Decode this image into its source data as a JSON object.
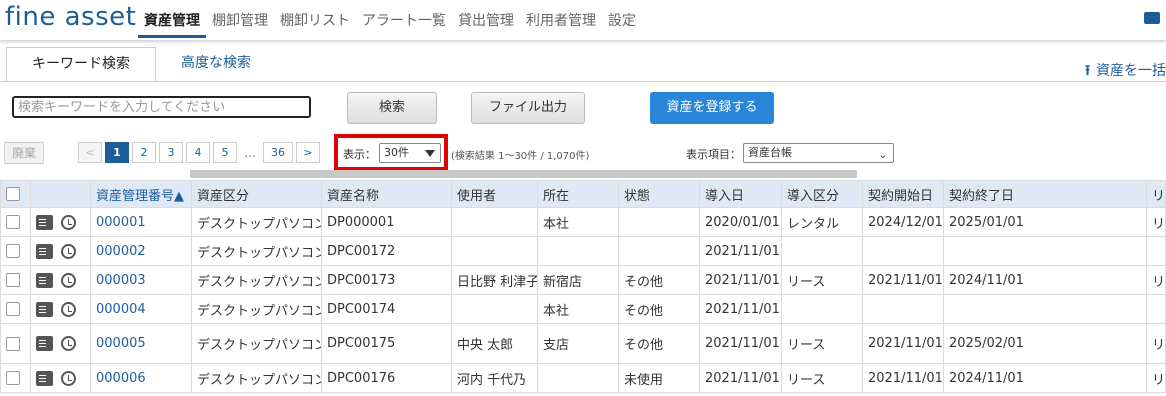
{
  "app": {
    "logo": "fine asset"
  },
  "nav": [
    {
      "label": "資産管理",
      "active": true
    },
    {
      "label": "棚卸管理"
    },
    {
      "label": "棚卸リスト"
    },
    {
      "label": "アラート一覧"
    },
    {
      "label": "貸出管理"
    },
    {
      "label": "利用者管理"
    },
    {
      "label": "設定"
    }
  ],
  "tabs": [
    {
      "label": "キーワード検索",
      "active": true
    },
    {
      "label": "高度な検索"
    }
  ],
  "bulk_link": {
    "label": "資産を一括"
  },
  "search": {
    "placeholder": "検索キーワードを入力してください",
    "button": "検索"
  },
  "toolbar": {
    "export": "ファイル出力",
    "register": "資産を登録する",
    "dispose": "廃棄"
  },
  "pager": {
    "prev": "<",
    "next": ">",
    "pages": [
      "1",
      "2",
      "3",
      "4",
      "5"
    ],
    "ellipsis": "...",
    "last": "36",
    "current": "1"
  },
  "display": {
    "label": "表示：",
    "value": "30件"
  },
  "result_text": "(検索結果 1～30件 / 1,070件)",
  "columns_select": {
    "label": "表示項目：",
    "value": "資産台帳"
  },
  "table": {
    "headers": [
      "資産管理番号▲",
      "資産区分",
      "資産名称",
      "使用者",
      "所在",
      "状態",
      "導入日",
      "導入区分",
      "契約開始日",
      "契約終了日",
      "リース・レンタル会社名"
    ],
    "rows": [
      [
        "000001",
        "デスクトップパソコン",
        "DP000001",
        "",
        "本社",
        "",
        "2020/01/01",
        "レンタル",
        "2024/12/01",
        "2025/01/01",
        "リース"
      ],
      [
        "000002",
        "デスクトップパソコン",
        "DPC00172",
        "",
        "",
        "",
        "2021/11/01",
        "",
        "",
        "",
        ""
      ],
      [
        "000003",
        "デスクトップパソコン",
        "DPC00173",
        "日比野 利津子",
        "新宿店",
        "その他",
        "2021/11/01",
        "リース",
        "2021/11/01",
        "2024/11/01",
        "リース株式会社"
      ],
      [
        "000004",
        "デスクトップパソコン",
        "DPC00174",
        "",
        "本社",
        "その他",
        "2021/11/01",
        "",
        "",
        "",
        ""
      ],
      [
        "000005",
        "デスクトップパソコン",
        "DPC00175",
        "中央 太郎",
        "支店",
        "その他",
        "2021/11/01",
        "リース",
        "2021/11/01",
        "2025/02/01",
        "リース株式会社"
      ],
      [
        "000006",
        "デスクトップパソコン",
        "DPC00176",
        "河内 千代乃",
        "",
        "未使用",
        "2021/11/01",
        "リース",
        "2021/11/01",
        "2024/11/01",
        "リース株式会社"
      ]
    ]
  }
}
